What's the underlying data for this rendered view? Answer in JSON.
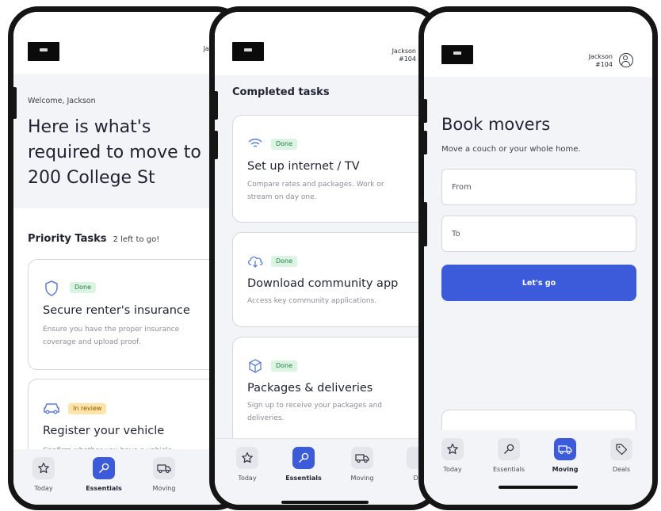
{
  "colors": {
    "accent": "#3b5bdb",
    "done_badge": "#d9f5e1",
    "review_badge": "#ffe3a8",
    "panel_bg": "#f3f4f8"
  },
  "user": {
    "name": "Jackson",
    "unit": "#104"
  },
  "phone1": {
    "welcome": "Welcome, Jackson",
    "headline_line1": "Here is what's",
    "headline_line2": "required to move to",
    "headline_line3": "200 College St",
    "priority_title": "Priority Tasks",
    "priority_count": "2 left to go!",
    "tasks": [
      {
        "badge": "Done",
        "title": "Secure renter's insurance",
        "desc_line1": "Ensure you have the proper insurance",
        "desc_line2": "coverage and upload proof.",
        "icon": "shield-icon"
      },
      {
        "badge": "In review",
        "title": "Register your vehicle",
        "desc_line1": "Confirm whether you have a vehicle",
        "icon": "car-icon"
      }
    ]
  },
  "phone2": {
    "section_title": "Completed tasks",
    "tasks": [
      {
        "badge": "Done",
        "title": "Set up internet / TV",
        "desc_line1": "Compare rates and packages. Work or",
        "desc_line2": "stream on day one.",
        "icon": "wifi-icon"
      },
      {
        "badge": "Done",
        "title": "Download community app",
        "desc_line1": "Access key community applications.",
        "icon": "cloud-download-icon"
      },
      {
        "badge": "Done",
        "title": "Packages & deliveries",
        "desc_line1": "Sign up to receive your packages and",
        "desc_line2": "deliveries.",
        "icon": "package-icon"
      }
    ]
  },
  "phone3": {
    "title": "Book movers",
    "subtitle": "Move a couch or your whole home.",
    "from_placeholder": "From",
    "to_placeholder": "To",
    "cta": "Let's go"
  },
  "nav": {
    "today": "Today",
    "essentials": "Essentials",
    "moving": "Moving",
    "deals": "Deals",
    "deals_cut": "De"
  }
}
